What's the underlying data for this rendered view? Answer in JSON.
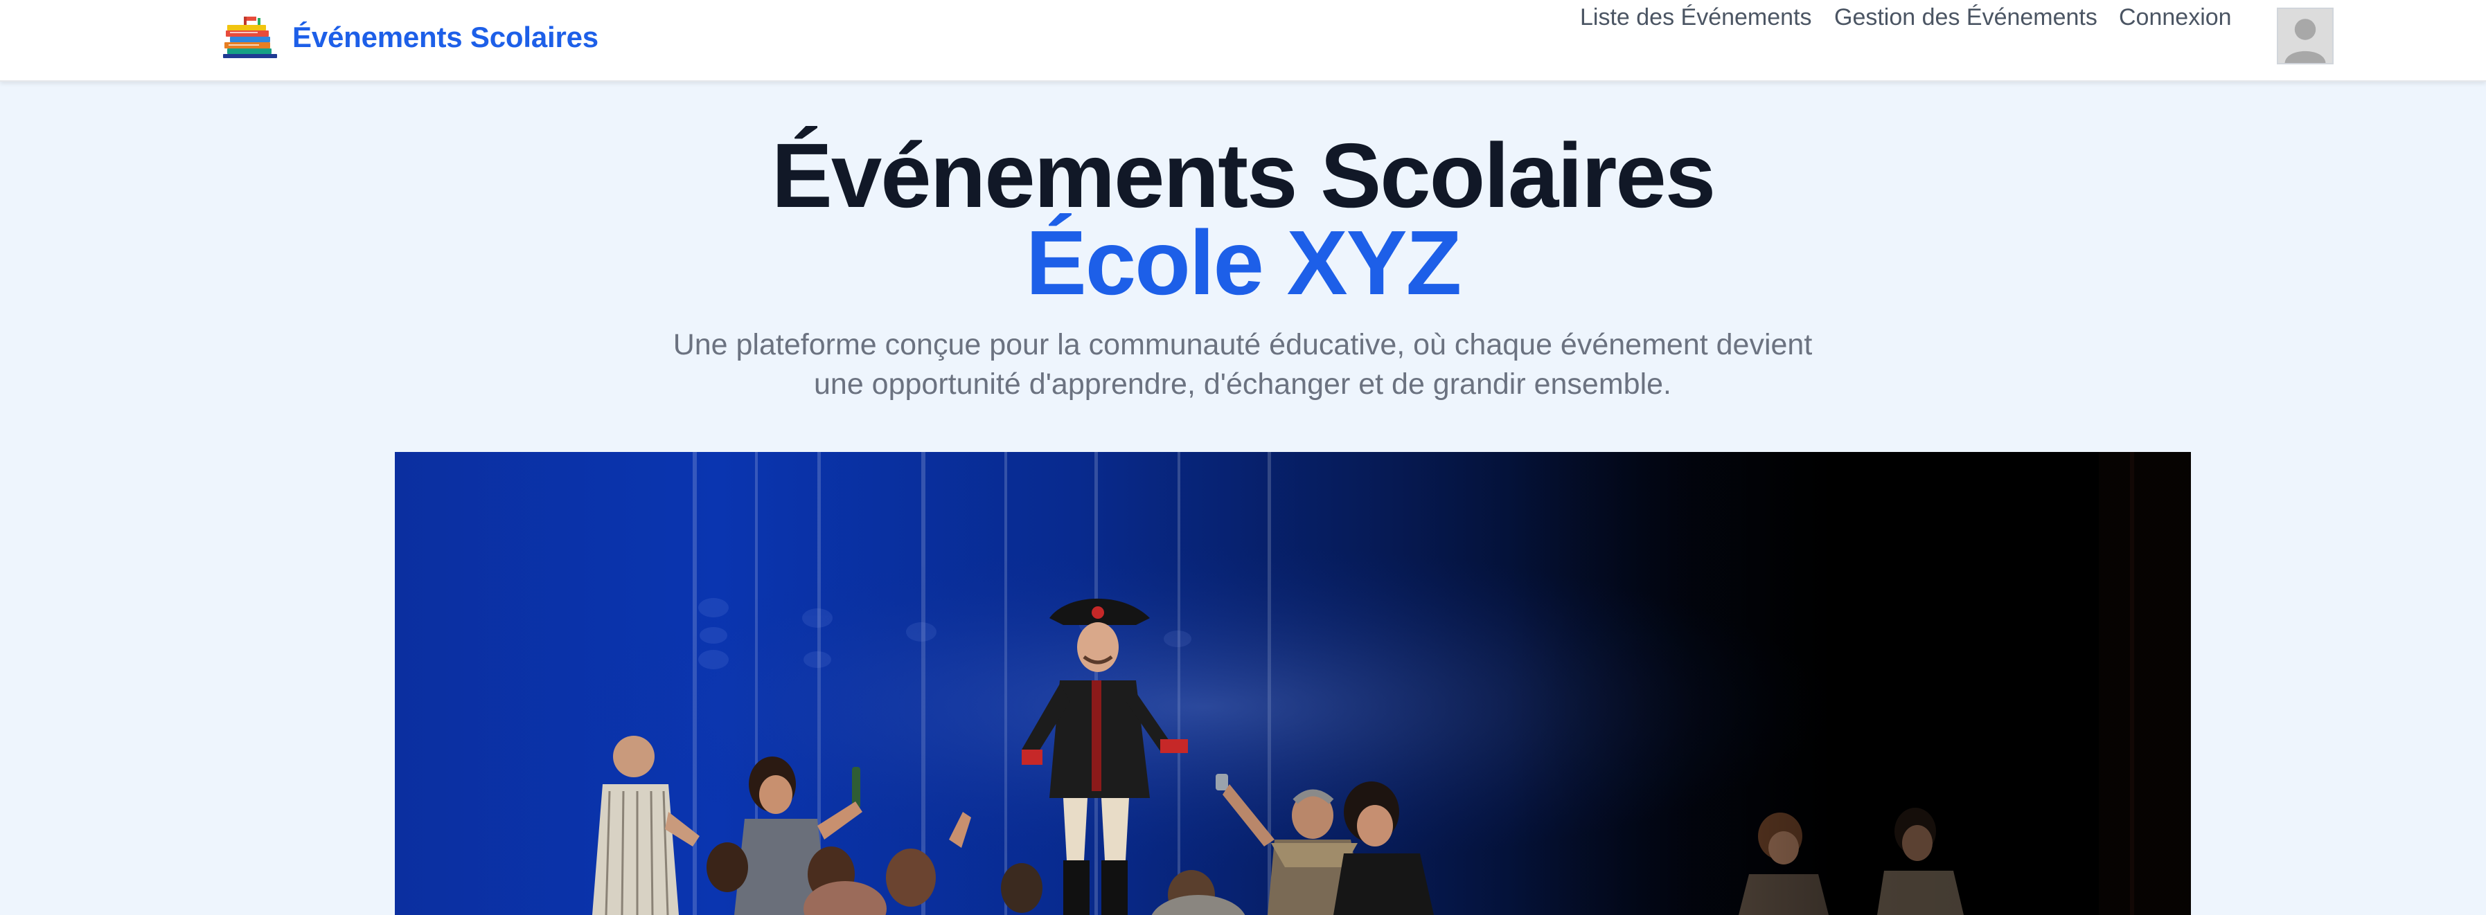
{
  "header": {
    "brand_name": "Événements Scolaires",
    "brand_icon": "books-stack-icon",
    "nav": [
      {
        "label": "Liste des Événements"
      },
      {
        "label": "Gestion des Événements"
      },
      {
        "label": "Connexion"
      }
    ],
    "avatar_icon": "user-avatar-icon"
  },
  "hero": {
    "title_line1": "Événements Scolaires",
    "title_line2": "École XYZ",
    "description": "Une plateforme conçue pour la communauté éducative, où chaque événement devient une opportunité d'apprendre, d'échanger et de grandir ensemble.",
    "image_subject": "stage-performance-photo"
  },
  "colors": {
    "accent": "#1d5fe8",
    "page_background": "#eef5fd",
    "title": "#111827",
    "muted_text": "#6b7280"
  }
}
